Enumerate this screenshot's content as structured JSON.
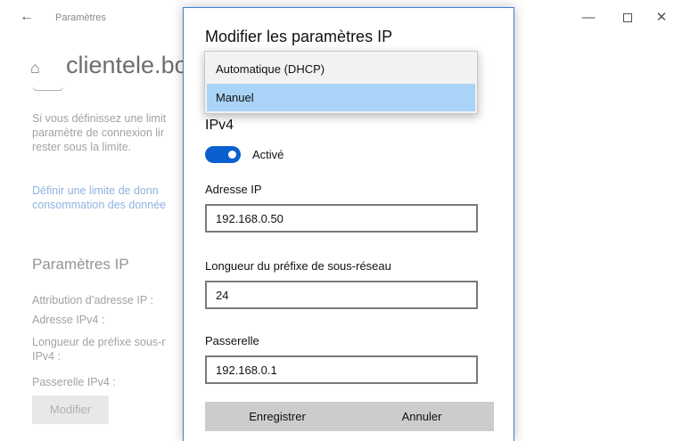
{
  "settings": {
    "app_title": "Paramètres",
    "page_heading": "clientele.bo",
    "description": "Si vous définissez une limite de données, Windows définira le paramètre de connexion limitée pour vous afin de vous aider à rester sous la limite.",
    "description_visible": "Si vous définissez une limit\nparamètre de connexion lir\nrester sous la limite.",
    "link": "Définir une limite de donn\nconsommation des donnée",
    "ip_section_title": "Paramètres IP",
    "props": {
      "attribution": "Attribution d’adresse IP :",
      "ipv4_address": "Adresse IPv4 :",
      "prefix_length": "Longueur de préfixe sous-r\nIPv4 :",
      "gateway": "Passerelle IPv4 :"
    },
    "modify_button": "Modifier"
  },
  "window_controls": {
    "back": "←",
    "minimize": "—",
    "close": "✕"
  },
  "dialog": {
    "title": "Modifier les paramètres IP",
    "dropdown": {
      "options": [
        "Automatique (DHCP)",
        "Manuel"
      ],
      "selected": "Manuel"
    },
    "ipv4_heading": "IPv4",
    "toggle_label": "Activé",
    "ip_address_label": "Adresse IP",
    "ip_address_value": "192.168.0.50",
    "prefix_label": "Longueur du préfixe de sous-réseau",
    "prefix_value": "24",
    "gateway_label": "Passerelle",
    "gateway_value": "192.168.0.1",
    "save_button": "Enregistrer",
    "cancel_button": "Annuler"
  },
  "colors": {
    "accent": "#0a5fcf",
    "dialog_border": "#3b7fd3",
    "selected_option": "#a9d3f7",
    "link": "#6f9ed8"
  }
}
